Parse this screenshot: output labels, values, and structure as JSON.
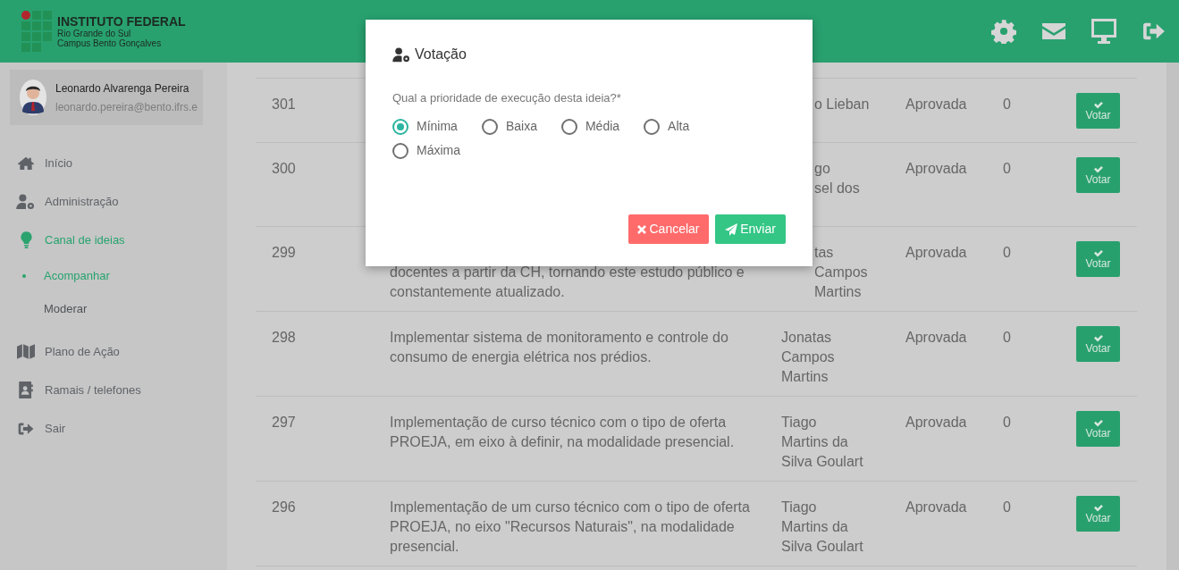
{
  "header": {
    "logo_title": "INSTITUTO FEDERAL",
    "logo_lines": [
      "Rio Grande do Sul",
      "Campus Bento Gonçalves"
    ]
  },
  "user": {
    "name": "Leonardo Alvarenga Pereira",
    "email": "leonardo.pereira@bento.ifrs.e"
  },
  "sidebar": {
    "items": [
      {
        "label": "Início",
        "selected": false
      },
      {
        "label": "Administração",
        "selected": false
      },
      {
        "label": "Canal de ideias",
        "selected": true,
        "children": [
          {
            "label": "Acompanhar",
            "selected": true
          },
          {
            "label": "Moderar",
            "selected": false
          }
        ]
      },
      {
        "label": "Plano de Ação",
        "selected": false
      },
      {
        "label": "Ramais / telefones",
        "selected": false
      },
      {
        "label": "Sair",
        "selected": false
      }
    ]
  },
  "table": {
    "rows": [
      {
        "id": "301",
        "description": "",
        "author": "o Lieban",
        "author_partly_covered": true,
        "status": "Aprovada",
        "votes": "0",
        "action": "Votar"
      },
      {
        "id": "300",
        "description": "",
        "author": "go\nsel dos",
        "author_partly_covered": true,
        "status": "Aprovada",
        "votes": "0",
        "action": "Votar"
      },
      {
        "id": "299",
        "description": "docentes a partir da CH, tornando este estudo público e constantemente atualizado.",
        "description_partly_covered": true,
        "author": "tas\nCampos\nMartins",
        "author_partly_covered": true,
        "status": "Aprovada",
        "votes": "0",
        "action": "Votar"
      },
      {
        "id": "298",
        "description": "Implementar sistema de monitoramento e controle do consumo de energia elétrica nos prédios.",
        "author": "Jonatas\nCampos\nMartins",
        "status": "Aprovada",
        "votes": "0",
        "action": "Votar"
      },
      {
        "id": "297",
        "description": "Implementação de curso técnico com o tipo de oferta PROEJA, em eixo à definir, na modalidade presencial.",
        "author": "Tiago\nMartins da\nSilva Goulart",
        "status": "Aprovada",
        "votes": "0",
        "action": "Votar"
      },
      {
        "id": "296",
        "description": "Implementação de um curso técnico com o tipo de oferta PROEJA, no eixo \"Recursos Naturais\", na modalidade presencial.",
        "author": "Tiago\nMartins da\nSilva Goulart",
        "status": "Aprovada",
        "votes": "0",
        "action": "Votar"
      }
    ]
  },
  "dialog": {
    "title": "Votação",
    "question": "Qual a prioridade de execução desta ideia?*",
    "options": [
      {
        "label": "Mínima",
        "selected": true
      },
      {
        "label": "Baixa",
        "selected": false
      },
      {
        "label": "Média",
        "selected": false
      },
      {
        "label": "Alta",
        "selected": false
      },
      {
        "label": "Máxima",
        "selected": false
      }
    ],
    "buttons": [
      {
        "label": "Cancelar",
        "kind": "cancel"
      },
      {
        "label": "Enviar",
        "kind": "submit"
      }
    ]
  }
}
